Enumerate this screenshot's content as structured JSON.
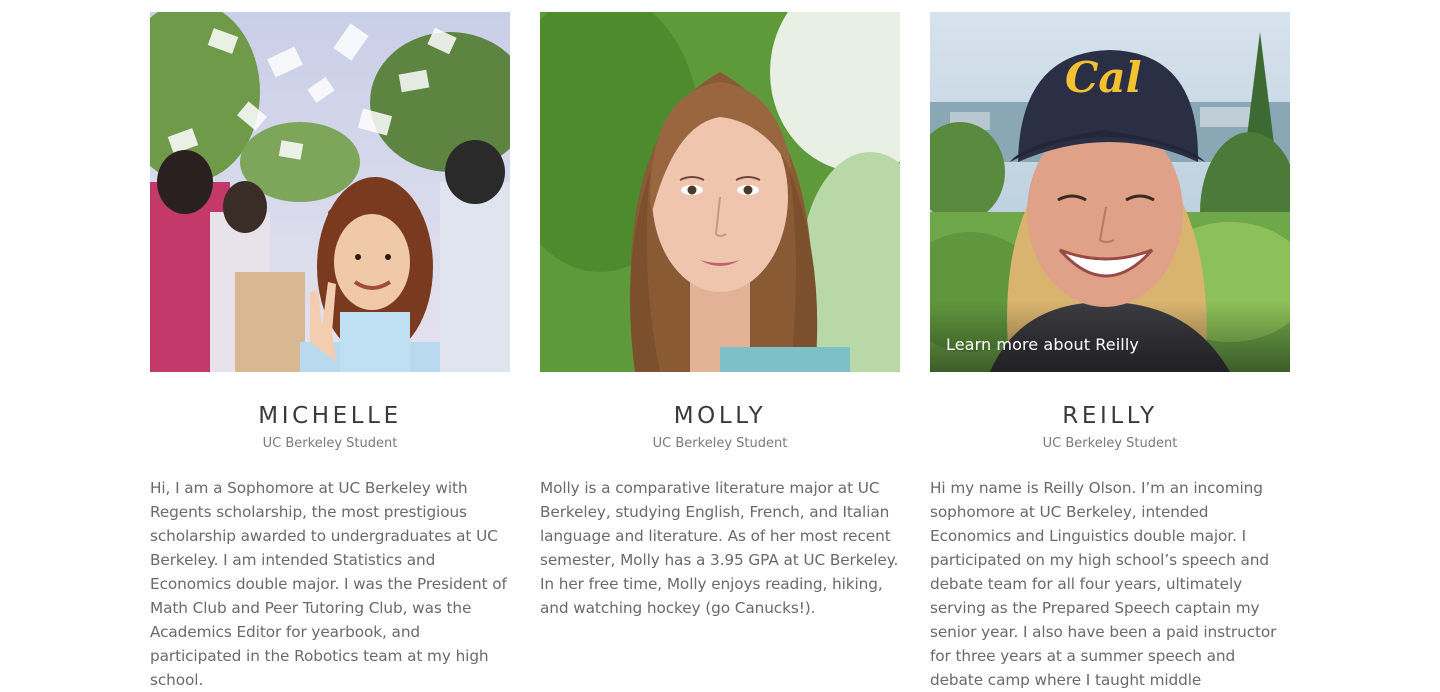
{
  "profiles": [
    {
      "name": "MICHELLE",
      "role": "UC Berkeley Student",
      "bio": "Hi, I am a Sophomore at UC Berkeley with Regents scholarship, the most prestigious scholarship awarded to undergraduates at UC Berkeley. I am intended Statistics and Economics double major. I was the President of Math Club and Peer Tutoring Club, was the Academics Editor for yearbook, and participated in the Robotics team at my high school.",
      "learn_more": ""
    },
    {
      "name": "MOLLY",
      "role": "UC Berkeley Student",
      "bio": "Molly is a comparative literature major at UC Berkeley, studying English, French, and Italian language and literature. As of her most recent semester, Molly has a 3.95 GPA at UC Berkeley. In her free time, Molly enjoys reading, hiking, and watching hockey (go Canucks!).",
      "learn_more": ""
    },
    {
      "name": "REILLY",
      "role": "UC Berkeley Student",
      "bio": "Hi my name is Reilly Olson. I’m an incoming sophomore at UC Berkeley, intended Economics and Linguistics double major. I participated on my high school’s speech and debate team for all four years, ultimately serving as the Prepared Speech captain my senior year. I also have been a paid instructor for three years at a summer speech and debate camp where I taught middle",
      "learn_more": "Learn more about Reilly",
      "cap_text": "Cal"
    }
  ],
  "colors": {
    "name": "#3a3a3a",
    "role": "#7a7a7a",
    "bio": "#6a6a6a",
    "cap_logo": "#f2c230",
    "cap": "#2b2f45"
  }
}
